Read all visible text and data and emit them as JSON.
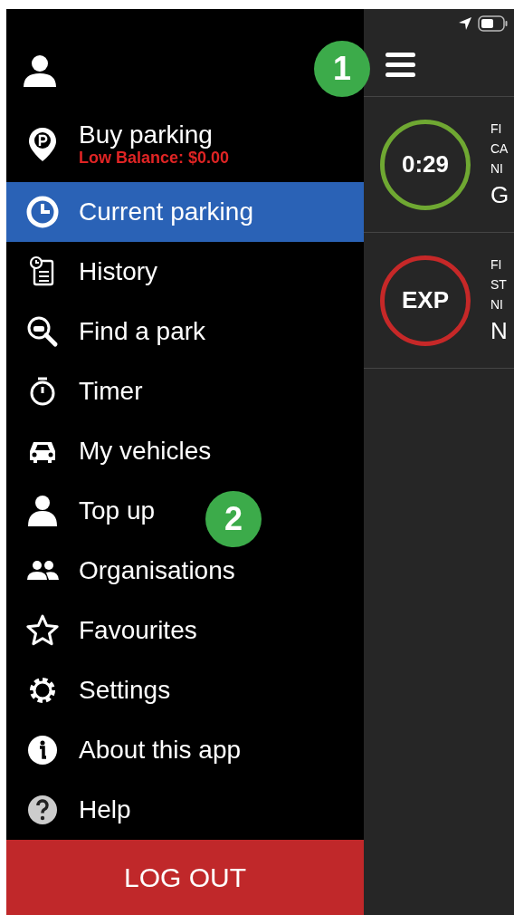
{
  "drawer": {
    "menu": [
      {
        "label": "Buy parking",
        "note": "Low Balance: $0.00",
        "selected": false
      },
      {
        "label": "Current parking",
        "selected": true
      },
      {
        "label": "History",
        "selected": false
      },
      {
        "label": "Find a park",
        "selected": false
      },
      {
        "label": "Timer",
        "selected": false
      },
      {
        "label": "My vehicles",
        "selected": false
      },
      {
        "label": "Top up",
        "selected": false
      },
      {
        "label": "Organisations",
        "selected": false
      },
      {
        "label": "Favourites",
        "selected": false
      },
      {
        "label": "Settings",
        "selected": false
      },
      {
        "label": "About this app",
        "selected": false
      },
      {
        "label": "Help",
        "selected": false
      }
    ],
    "logout": "LOG OUT"
  },
  "parking_sessions": [
    {
      "timer": "0:29",
      "color": "#6fa832",
      "lines": [
        "FI",
        "CA",
        "NI"
      ],
      "title": "G"
    },
    {
      "timer": "EXP",
      "color": "#c62828",
      "lines": [
        "FI",
        "ST",
        "NI"
      ],
      "title": "N"
    }
  ],
  "annotations": [
    {
      "label": "1"
    },
    {
      "label": "2"
    }
  ]
}
